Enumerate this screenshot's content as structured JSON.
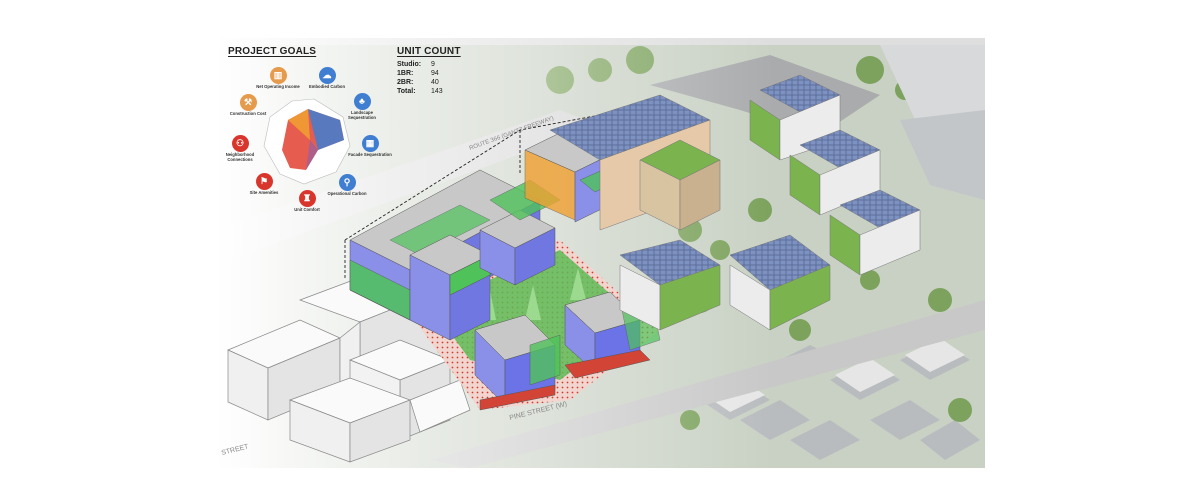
{
  "project_goals": {
    "title": "PROJECT GOALS",
    "goals": [
      {
        "label": "Net Operating Income",
        "icon": "bar-chart-icon",
        "color": "#e59a4c"
      },
      {
        "label": "Embodied Carbon",
        "icon": "carbon-cloud-icon",
        "color": "#3f7ed1"
      },
      {
        "label": "Landscape Sequestration",
        "icon": "tree-icon",
        "color": "#3f7ed1"
      },
      {
        "label": "Facade Sequestration",
        "icon": "facade-icon",
        "color": "#3f7ed1"
      },
      {
        "label": "Operational Carbon",
        "icon": "thermometer-icon",
        "color": "#3f7ed1"
      },
      {
        "label": "Unit Comfort",
        "icon": "person-icon",
        "color": "#d8362d"
      },
      {
        "label": "Site Amenities",
        "icon": "amenity-icon",
        "color": "#d8362d"
      },
      {
        "label": "Neighborhood Connections",
        "icon": "people-icon",
        "color": "#d8362d"
      },
      {
        "label": "Construction Cost",
        "icon": "crane-icon",
        "color": "#e59a4c"
      }
    ]
  },
  "unit_count": {
    "title": "UNIT COUNT",
    "rows": [
      {
        "label": "Studio:",
        "value": "9"
      },
      {
        "label": "1BR:",
        "value": "94"
      },
      {
        "label": "2BR:",
        "value": "40"
      },
      {
        "label": "Total:",
        "value": "143"
      }
    ]
  },
  "site_labels": {
    "route": "ROUTE 366 (GANTZ FREEWAY)",
    "pine_street": "PINE STREET (W)",
    "street_partial": "STREET"
  },
  "colors": {
    "volume_green": "#4fc35a",
    "volume_blue": "#6b73e6",
    "volume_gray": "#c8c8c8",
    "volume_orange": "#f0a030",
    "courtyard_red": "#d24436"
  }
}
